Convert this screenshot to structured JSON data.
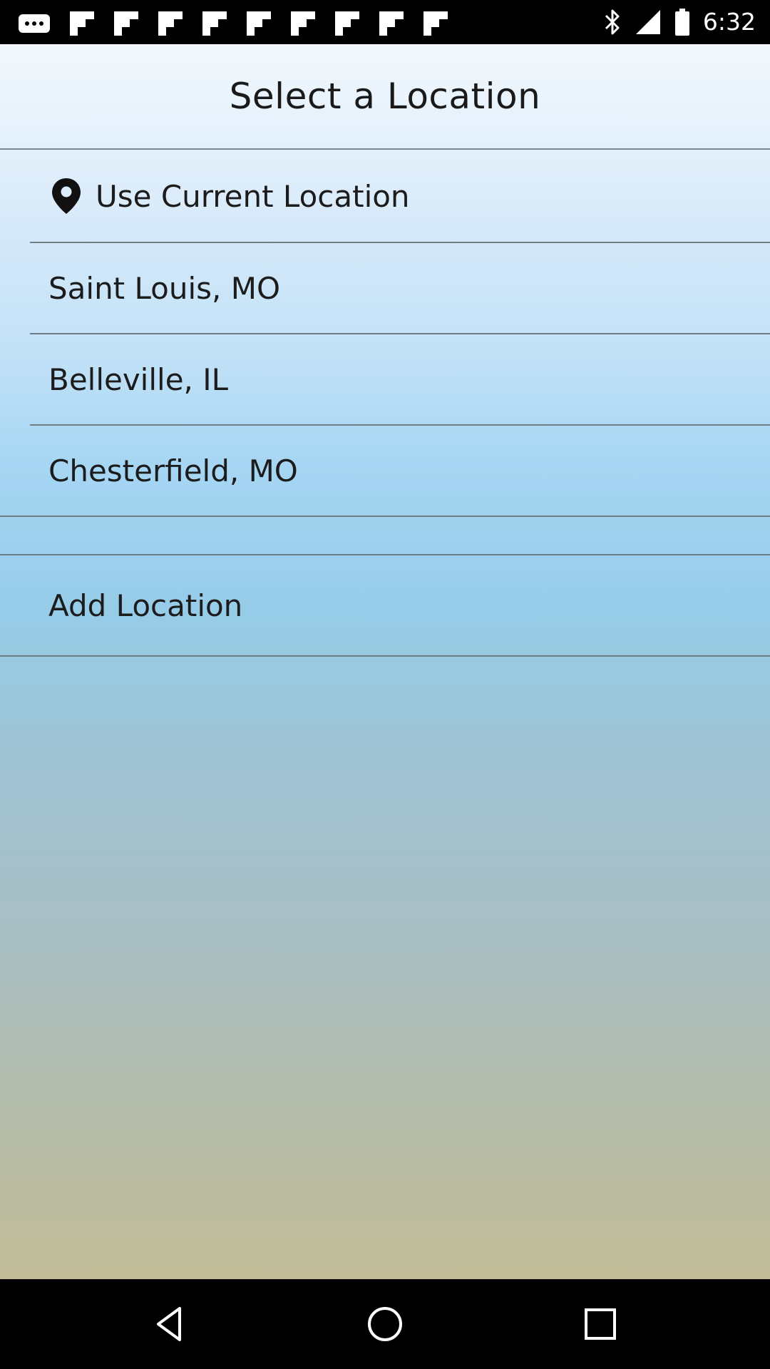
{
  "status_bar": {
    "time": "6:32",
    "notification_icons": [
      "flipboard-icon",
      "flipboard-icon",
      "flipboard-icon",
      "flipboard-icon",
      "flipboard-icon",
      "flipboard-icon",
      "flipboard-icon",
      "flipboard-icon",
      "flipboard-icon"
    ],
    "system_icons": [
      "bluetooth-icon",
      "signal-icon",
      "battery-icon"
    ]
  },
  "header": {
    "title": "Select a Location"
  },
  "locations": {
    "current_location_label": "Use Current Location",
    "items": [
      {
        "label": "Saint Louis, MO"
      },
      {
        "label": "Belleville, IL"
      },
      {
        "label": "Chesterfield, MO"
      }
    ],
    "add_label": "Add Location"
  },
  "nav_bar": {
    "buttons": [
      "back-icon",
      "home-icon",
      "recents-icon"
    ]
  }
}
